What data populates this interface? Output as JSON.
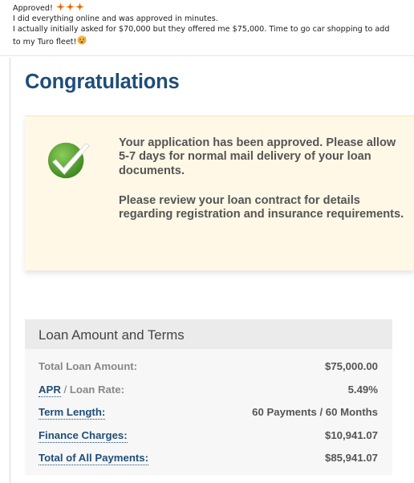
{
  "post": {
    "line1": "Approved!",
    "line2": "I did everything online and was approved in minutes.",
    "line3": "I actually initially asked for $70,000 but they offered me $75,000. Time to go car shopping to add",
    "line4": "to my Turo fleet!",
    "emojis": [
      "sparkle-burst",
      "sparkle-burst",
      "sparkle-burst",
      "hot-face"
    ]
  },
  "page": {
    "title": "Congratulations"
  },
  "notice": {
    "paragraph1": "Your application has been approved. Please allow 5-7 days for normal mail delivery of your loan documents.",
    "paragraph2": "Please review your loan contract for details regarding registration and insurance requirements."
  },
  "terms": {
    "header": "Loan Amount and Terms",
    "total_loan_label": "Total Loan Amount:",
    "total_loan_value": "$75,000.00",
    "apr_label": "APR",
    "apr_separator": " / ",
    "loan_rate_label": "Loan Rate:",
    "apr_value": "5.49%",
    "term_label": "Term Length:",
    "term_value": "60 Payments / 60 Months",
    "finance_label": "Finance Charges:",
    "finance_value": "$10,941.07",
    "total_payments_label": "Total of All Payments:",
    "total_payments_value": "$85,941.07"
  },
  "colors": {
    "title_blue": "#1f4e79",
    "notice_bg": "#fff8e6",
    "check_green": "#5aa52f"
  }
}
